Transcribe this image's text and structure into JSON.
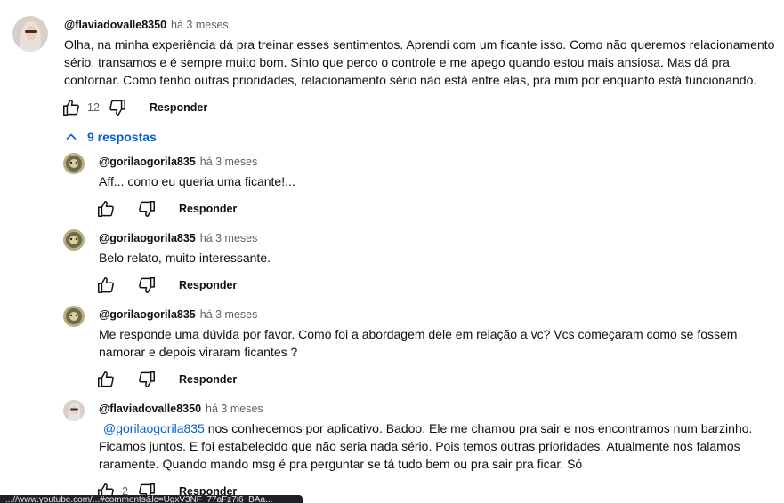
{
  "comment": {
    "author": "@flaviadovalle8350",
    "time": "há 3 meses",
    "text": "Olha, na minha experiência dá pra treinar esses sentimentos. Aprendi com um ficante isso. Como não queremos relacionamento sério, transamos e é sempre muito bom. Sinto que perco o controle e me apego quando estou mais ansiosa. Mas dá pra contornar. Como tenho outras prioridades, relacionamento sério não está entre elas, pra mim por enquanto está funcionando.",
    "likes": "12",
    "reply_label": "Responder",
    "like_icon": "like-icon",
    "dislike_icon": "dislike-icon"
  },
  "replies_toggle": {
    "label": "9 respostas",
    "icon": "chevron-up-icon"
  },
  "replies": [
    {
      "author": "@gorilaogorila835",
      "time": "há 3 meses",
      "text": "Aff... como eu queria uma ficante!...",
      "likes": "",
      "reply_label": "Responder"
    },
    {
      "author": "@gorilaogorila835",
      "time": "há 3 meses",
      "text": "Belo relato, muito interessante.",
      "likes": "",
      "reply_label": "Responder"
    },
    {
      "author": "@gorilaogorila835",
      "time": "há 3 meses",
      "text": "Me responde uma dúvida por favor. Como foi a abordagem dele em relação a vc? Vcs começaram como se fossem namorar e depois viraram ficantes ?",
      "likes": "",
      "reply_label": "Responder"
    },
    {
      "author": "@flaviadovalle8350",
      "time": "há 3 meses",
      "mention": "@gorilaogorila835",
      "text": " nos conhecemos por aplicativo. Badoo. Ele me chamou pra sair e nos encontramos num barzinho. Ficamos juntos. E foi estabelecido que não seria nada sério. Pois temos outras prioridades. Atualmente nos falamos raramente. Quando mando msg é pra perguntar se tá tudo bem ou pra sair pra ficar. Só",
      "likes": "2",
      "reply_label": "Responder"
    }
  ],
  "status_bar": {
    "text": "...//www.youtube.com/...#comments&lc=UgxV3NF_77aFz7i6_BAa..."
  },
  "colors": {
    "link": "#065fd4",
    "text": "#0f0f0f",
    "secondary": "#606060"
  }
}
